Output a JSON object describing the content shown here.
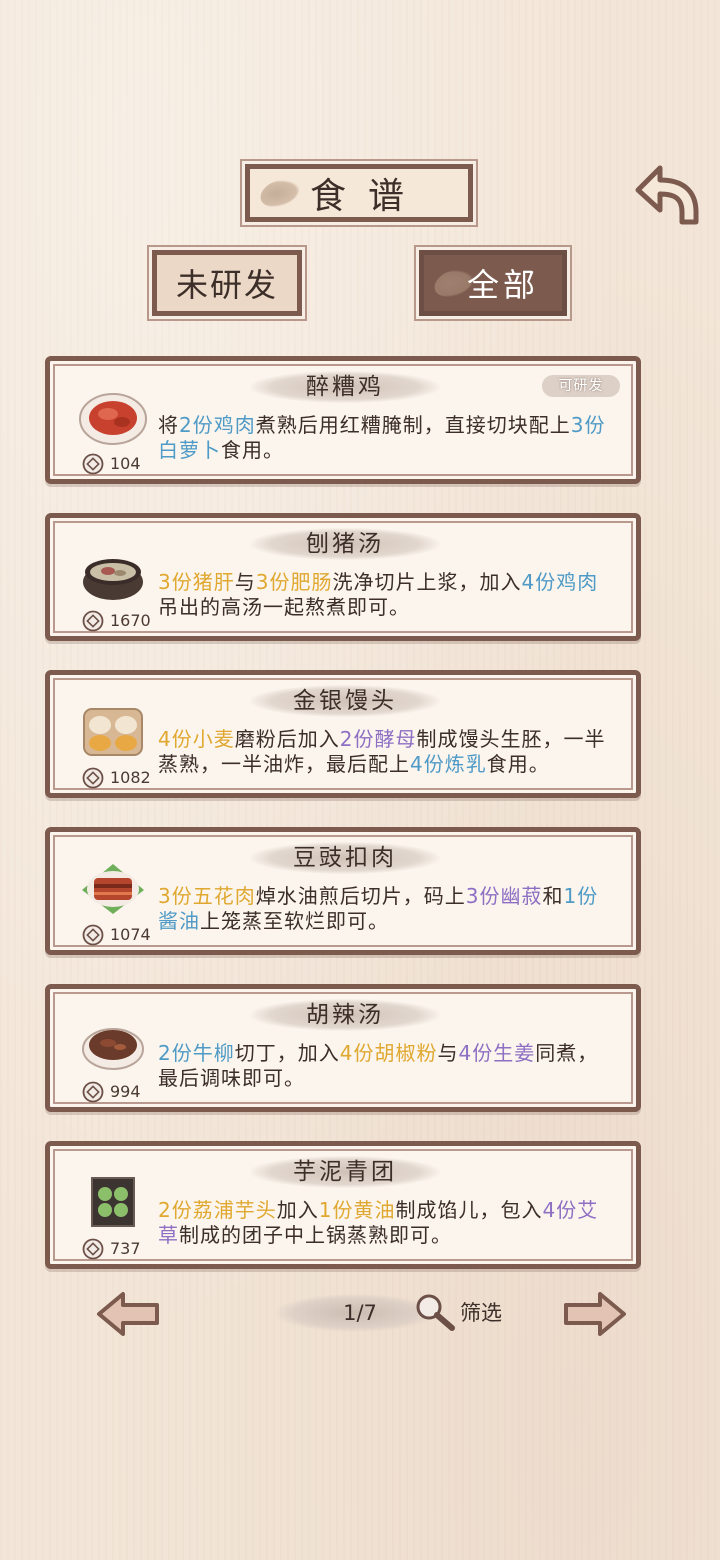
{
  "header": {
    "title": "食谱",
    "filter_undeveloped": "未研发",
    "filter_all": "全部"
  },
  "colors": {
    "frame": "#7c5a4e",
    "blue_ingredient": "#4f9ac6",
    "yellow_ingredient": "#e0a830",
    "purple_ingredient": "#8e6fc4"
  },
  "recipes": [
    {
      "name": "醉糟鸡",
      "badge": "可研发",
      "cost": "104",
      "dish_icon": "red-chicken-plate",
      "desc": [
        {
          "t": "将",
          "c": ""
        },
        {
          "t": "2份鸡肉",
          "c": "blue"
        },
        {
          "t": "煮熟后用红糟腌制，直接切块配上",
          "c": ""
        },
        {
          "t": "3份白萝卜",
          "c": "blue"
        },
        {
          "t": "食用。",
          "c": ""
        }
      ]
    },
    {
      "name": "刨猪汤",
      "cost": "1670",
      "dish_icon": "pork-soup-pot",
      "desc": [
        {
          "t": "3份猪肝",
          "c": "yellow"
        },
        {
          "t": "与",
          "c": ""
        },
        {
          "t": "3份肥肠",
          "c": "yellow"
        },
        {
          "t": "洗净切片上浆，加入",
          "c": ""
        },
        {
          "t": "4份鸡肉",
          "c": "blue"
        },
        {
          "t": "吊出的高汤一起熬煮即可。",
          "c": ""
        }
      ]
    },
    {
      "name": "金银馒头",
      "cost": "1082",
      "dish_icon": "steamed-buns-basket",
      "desc": [
        {
          "t": "4份小麦",
          "c": "yellow"
        },
        {
          "t": "磨粉后加入",
          "c": ""
        },
        {
          "t": "2份酵母",
          "c": "purple"
        },
        {
          "t": "制成馒头生胚，一半蒸熟，一半油炸，最后配上",
          "c": ""
        },
        {
          "t": "4份炼乳",
          "c": "blue"
        },
        {
          "t": "食用。",
          "c": ""
        }
      ]
    },
    {
      "name": "豆豉扣肉",
      "cost": "1074",
      "dish_icon": "braised-pork-plate",
      "desc": [
        {
          "t": "3份五花肉",
          "c": "yellow"
        },
        {
          "t": "焯水油煎后切片，码上",
          "c": ""
        },
        {
          "t": "3份幽菽",
          "c": "purple"
        },
        {
          "t": "和",
          "c": ""
        },
        {
          "t": "1份酱油",
          "c": "blue"
        },
        {
          "t": "上笼蒸至软烂即可。",
          "c": ""
        }
      ]
    },
    {
      "name": "胡辣汤",
      "cost": "994",
      "dish_icon": "spicy-soup-bowl",
      "desc": [
        {
          "t": "2份牛柳",
          "c": "blue"
        },
        {
          "t": "切丁，加入",
          "c": ""
        },
        {
          "t": "4份胡椒粉",
          "c": "yellow"
        },
        {
          "t": "与",
          "c": ""
        },
        {
          "t": "4份生姜",
          "c": "purple"
        },
        {
          "t": "同煮，最后调味即可。",
          "c": ""
        }
      ]
    },
    {
      "name": "芋泥青团",
      "cost": "737",
      "dish_icon": "green-dumplings-tray",
      "desc": [
        {
          "t": "2份荔浦芋头",
          "c": "yellow"
        },
        {
          "t": "加入",
          "c": ""
        },
        {
          "t": "1份黄油",
          "c": "yellow"
        },
        {
          "t": "制成馅儿，包入",
          "c": ""
        },
        {
          "t": "4份艾草",
          "c": "purple"
        },
        {
          "t": "制成的团子中上锅蒸熟即可。",
          "c": ""
        }
      ]
    }
  ],
  "footer": {
    "page": "1/7",
    "filter_label": "筛选"
  }
}
